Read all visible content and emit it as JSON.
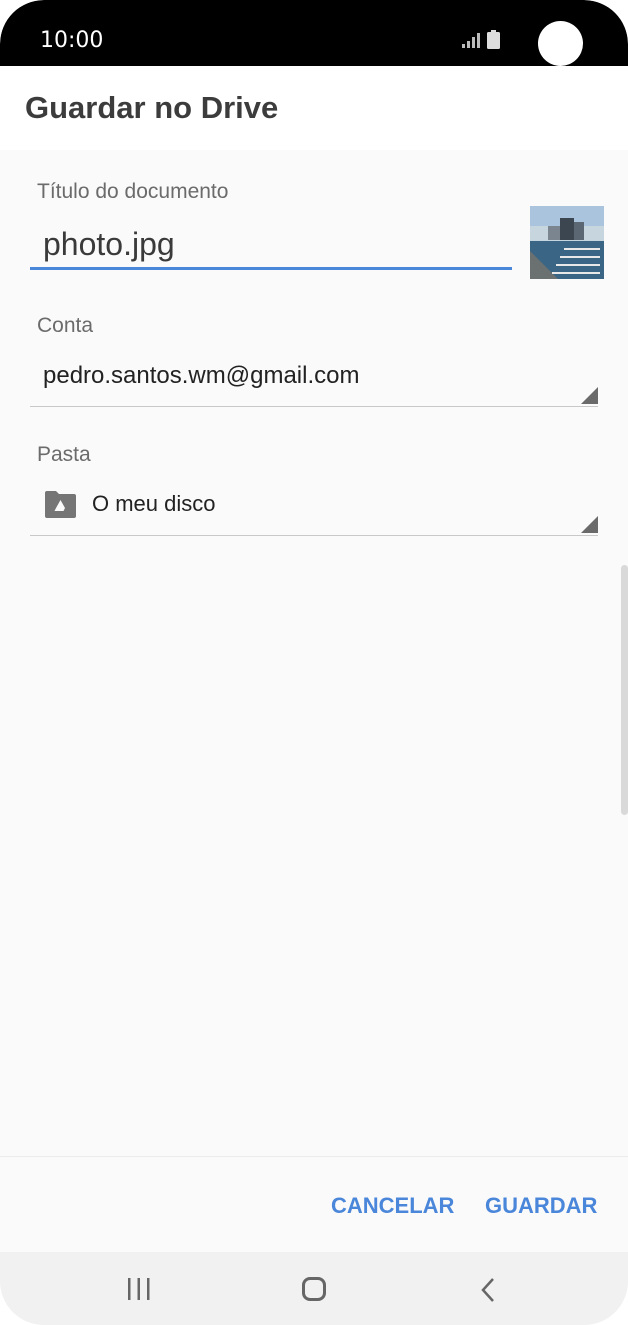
{
  "status_bar": {
    "time": "10:00"
  },
  "header": {
    "title": "Guardar no Drive"
  },
  "form": {
    "title_field": {
      "label": "Título do documento",
      "value": "photo.jpg"
    },
    "account_field": {
      "label": "Conta",
      "value": "pedro.santos.wm@gmail.com"
    },
    "folder_field": {
      "label": "Pasta",
      "value": "O meu disco",
      "icon": "drive-folder-icon"
    }
  },
  "actions": {
    "cancel_label": "CANCELAR",
    "save_label": "GUARDAR"
  },
  "colors": {
    "accent": "#4a86d9",
    "status_bar": "#000000",
    "background": "#fafafa"
  }
}
